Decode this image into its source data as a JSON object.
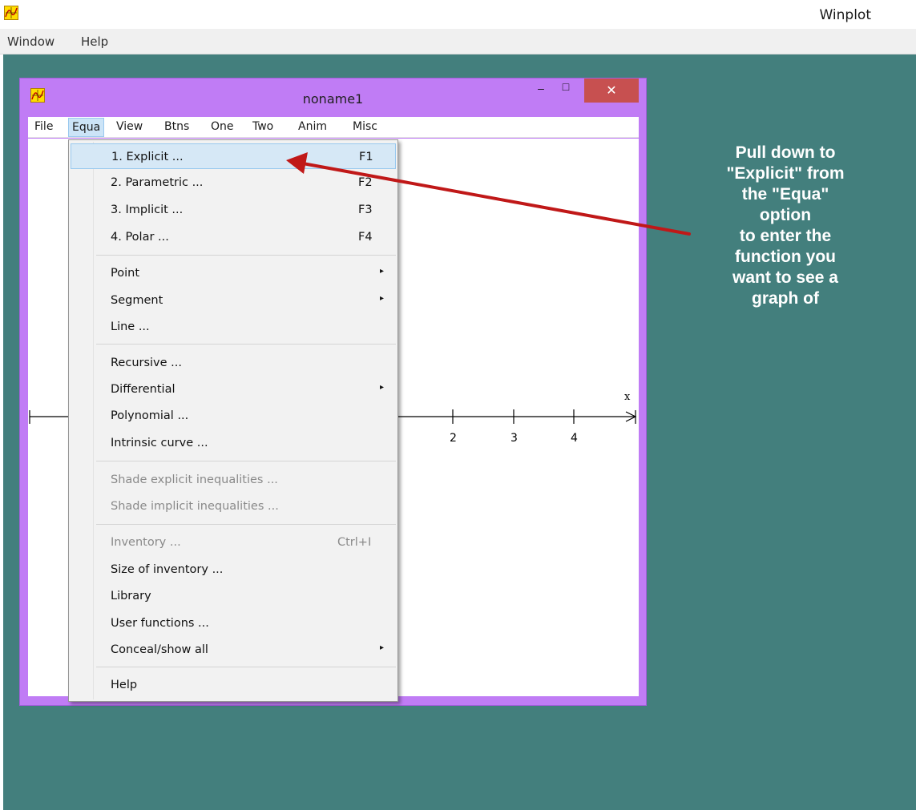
{
  "app": {
    "title": "Winplot",
    "menu": [
      "Window",
      "Help"
    ]
  },
  "child_window": {
    "title": "noname1",
    "controls": {
      "minimize": "–",
      "maximize": "□",
      "close": "✕"
    },
    "menu": [
      "File",
      "Equa",
      "View",
      "Btns",
      "One",
      "Two",
      "Anim",
      "Misc"
    ],
    "active_menu": "Equa"
  },
  "dropdown": {
    "items": [
      {
        "label": "1. Explicit ...",
        "shortcut": "F1"
      },
      {
        "label": "2. Parametric ...",
        "shortcut": "F2"
      },
      {
        "label": "3. Implicit ...",
        "shortcut": "F3"
      },
      {
        "label": "4. Polar ...",
        "shortcut": "F4"
      },
      {
        "label": "Point"
      },
      {
        "label": "Segment"
      },
      {
        "label": "Line ..."
      },
      {
        "label": "Recursive ..."
      },
      {
        "label": "Differential"
      },
      {
        "label": "Polynomial ..."
      },
      {
        "label": "Intrinsic curve ..."
      },
      {
        "label": "Shade explicit inequalities ..."
      },
      {
        "label": "Shade implicit inequalities ..."
      },
      {
        "label": "Inventory ...",
        "shortcut": "Ctrl+I"
      },
      {
        "label": "Size of inventory ..."
      },
      {
        "label": "Library"
      },
      {
        "label": "User functions ..."
      },
      {
        "label": "Conceal/show all"
      },
      {
        "label": "Help"
      }
    ],
    "submenu_arrow": "▸"
  },
  "plot": {
    "axis_label": "x",
    "ticks": [
      "2",
      "3",
      "4"
    ]
  },
  "annotation": {
    "lines": [
      "Pull down to",
      "\"Explicit\" from",
      "the \"Equa\"",
      "option",
      "to enter the",
      "function you",
      "want to see a",
      "graph of"
    ]
  },
  "colors": {
    "client_bg": "#437f7d",
    "child_frame": "#c07cf5",
    "close_button": "#c75050",
    "menu_highlight": "#d6e8f6",
    "arrow": "#c01818"
  }
}
